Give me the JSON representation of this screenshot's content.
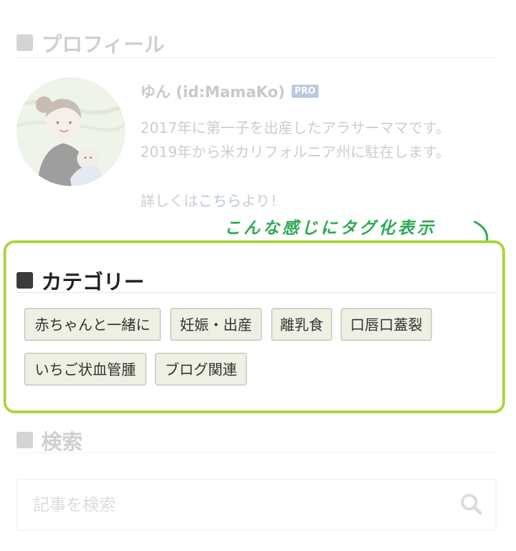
{
  "profile": {
    "section_title": "プロフィール",
    "name": "ゆん (id:MamaKo)",
    "badge": "PRO",
    "bio_line_1": "2017年に第一子を出産したアラサーママです。",
    "bio_line_2": "2019年から米カリフォルニア州に駐在します。",
    "bio_line_3_before": "詳しくは",
    "bio_line_3_link": "こちら",
    "bio_line_3_after": "より！"
  },
  "annotation": {
    "text": "こんな感じにタグ化表示",
    "color": "#2eaa55"
  },
  "highlight_color": "#a9d63b",
  "category": {
    "section_title": "カテゴリー",
    "tags": [
      "赤ちゃんと一緒に",
      "妊娠・出産",
      "離乳食",
      "口唇口蓋裂",
      "いちご状血管腫",
      "ブログ関連"
    ]
  },
  "search": {
    "section_title": "検索",
    "placeholder": "記事を検索",
    "icon": "search-icon"
  }
}
